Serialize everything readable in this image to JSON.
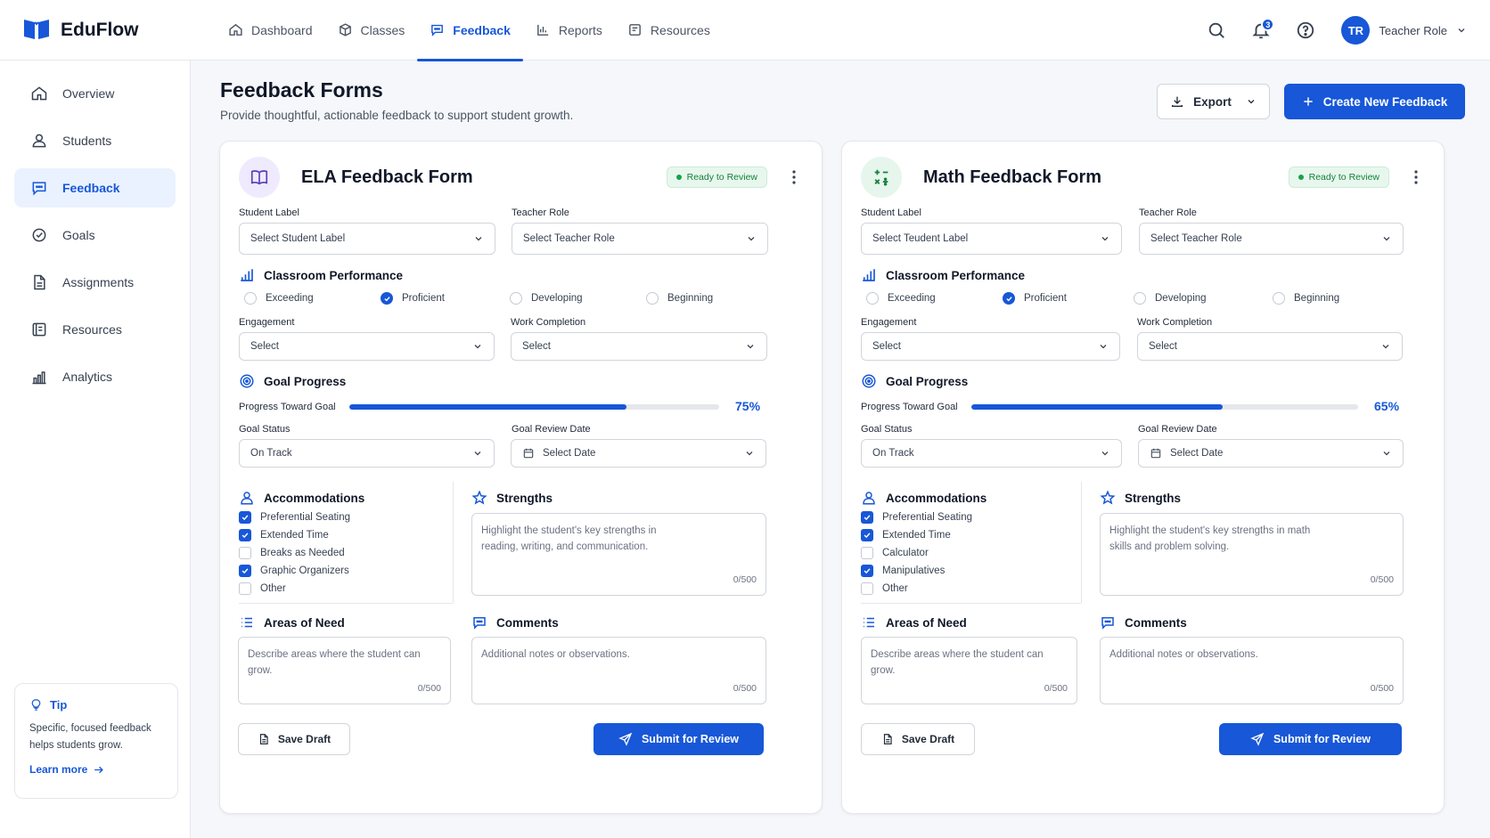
{
  "app": {
    "name": "EduFlow",
    "brand_color": "#1757d8"
  },
  "nav": [
    {
      "label": "Dashboard",
      "icon": "home-icon"
    },
    {
      "label": "Classes",
      "icon": "cube-icon"
    },
    {
      "label": "Feedback",
      "icon": "chat-icon",
      "active": true
    },
    {
      "label": "Reports",
      "icon": "bar-chart-icon"
    },
    {
      "label": "Resources",
      "icon": "book-icon"
    }
  ],
  "user": {
    "initials": "TR",
    "name": "Teacher Role",
    "notifications": "3"
  },
  "sidebar": {
    "items": [
      {
        "label": "Overview",
        "icon": "home-icon"
      },
      {
        "label": "Students",
        "icon": "user-icon"
      },
      {
        "label": "Feedback",
        "icon": "chat-icon",
        "active": true
      },
      {
        "label": "Goals",
        "icon": "target-icon"
      },
      {
        "label": "Assignments",
        "icon": "document-icon"
      },
      {
        "label": "Resources",
        "icon": "book-icon"
      },
      {
        "label": "Analytics",
        "icon": "analytics-icon"
      }
    ],
    "tip": {
      "title": "Tip",
      "text": "Specific, focused feedback helps students grow.",
      "link": "Learn more"
    }
  },
  "page": {
    "title": "Feedback Forms",
    "subtitle": "Provide thoughtful, actionable feedback to support student growth.",
    "export_label": "Export",
    "create_label": "Create New Feedback"
  },
  "forms": {
    "ela": {
      "title": "ELA Feedback Form",
      "status": "Ready to Review",
      "student_label": "Student Label",
      "student_placeholder": "Select Student Label",
      "teacher_label": "Teacher Role",
      "teacher_placeholder": "Select Teacher Role",
      "performance_title": "Classroom Performance",
      "performance_options": [
        "Exceeding",
        "Proficient",
        "Developing",
        "Beginning"
      ],
      "performance_selected": 1,
      "engagement_label": "Engagement",
      "engagement_value": "Select",
      "completion_label": "Work Completion",
      "completion_value": "Select",
      "goal_title": "Goal Progress",
      "progress_label": "Progress Toward Goal",
      "progress_value": 75,
      "progress_text": "75%",
      "goal_status_label": "Goal Status",
      "goal_status_value": "On Track",
      "review_date_label": "Goal Review Date",
      "review_date_value": "Select Date",
      "accommodations_title": "Accommodations",
      "accommodations": [
        {
          "label": "Preferential Seating",
          "checked": true
        },
        {
          "label": "Extended Time",
          "checked": true
        },
        {
          "label": "Breaks as Needed",
          "checked": false
        },
        {
          "label": "Graphic Organizers",
          "checked": true
        },
        {
          "label": "Other",
          "checked": false
        }
      ],
      "strengths_title": "Strengths",
      "strengths_placeholder": "Highlight the student's key strengths in reading, writing, and communication.",
      "strengths_count": "0/500",
      "needs_title": "Areas of Need",
      "needs_placeholder": "Describe areas where the student can grow.",
      "needs_count": "0/500",
      "comments_title": "Comments",
      "comments_placeholder": "Additional notes or observations.",
      "comments_count": "0/500",
      "save_label": "Save Draft",
      "submit_label": "Submit for Review"
    },
    "math": {
      "title": "Math Feedback Form",
      "status": "Ready to Review",
      "student_label": "Student Label",
      "student_placeholder": "Select Teudent Label",
      "teacher_label": "Teacher Role",
      "teacher_placeholder": "Select Teacher Role",
      "performance_title": "Classroom Performance",
      "performance_options": [
        "Exceeding",
        "Proficient",
        "Developing",
        "Beginning"
      ],
      "performance_selected": 1,
      "engagement_label": "Engagement",
      "engagement_value": "Select",
      "completion_label": "Work Completion",
      "completion_value": "Select",
      "goal_title": "Goal Progress",
      "progress_label": "Progress Toward Goal",
      "progress_value": 65,
      "progress_text": "65%",
      "goal_status_label": "Goal Status",
      "goal_status_value": "On Track",
      "review_date_label": "Goal Review Date",
      "review_date_value": "Select Date",
      "accommodations_title": "Accommodations",
      "accommodations": [
        {
          "label": "Preferential Seating",
          "checked": true
        },
        {
          "label": "Extended Time",
          "checked": true
        },
        {
          "label": "Calculator",
          "checked": false
        },
        {
          "label": "Manipulatives",
          "checked": true
        },
        {
          "label": "Other",
          "checked": false
        }
      ],
      "strengths_title": "Strengths",
      "strengths_placeholder": "Highlight the student's key strengths in math skills and problem solving.",
      "strengths_count": "0/500",
      "needs_title": "Areas of Need",
      "needs_placeholder": "Describe areas where the student can grow.",
      "needs_count": "0/500",
      "comments_title": "Comments",
      "comments_placeholder": "Additional notes or observations.",
      "comments_count": "0/500",
      "save_label": "Save Draft",
      "submit_label": "Submit for Review"
    }
  }
}
